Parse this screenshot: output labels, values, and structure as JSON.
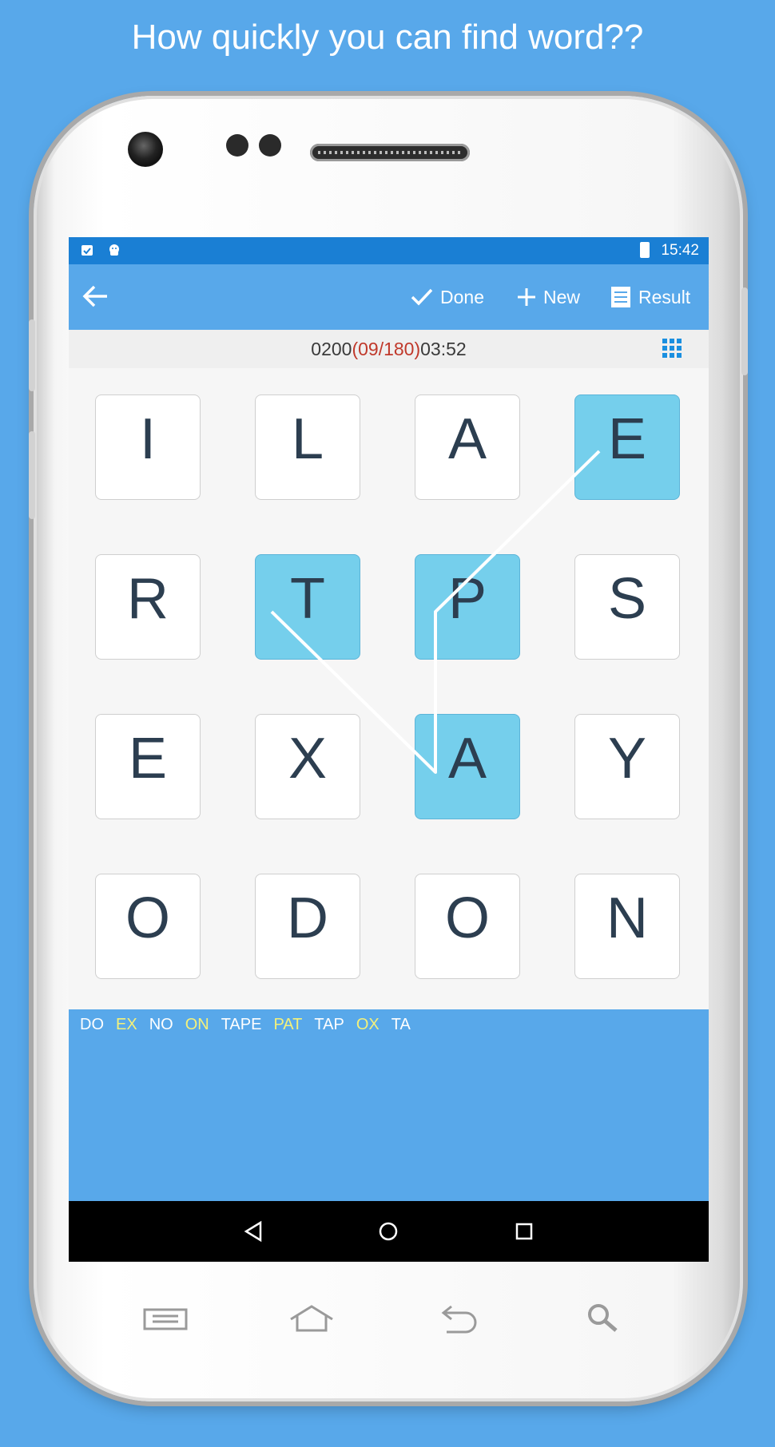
{
  "headline": "How quickly you can find word??",
  "status_bar": {
    "time": "15:42",
    "icons": [
      "clipboard-check-icon",
      "android-icon",
      "battery-charging-icon"
    ]
  },
  "toolbar": {
    "back_icon": "arrow-left-icon",
    "done_label": "Done",
    "new_label": "New",
    "result_label": "Result"
  },
  "score_bar": {
    "score": "0200",
    "found": "(09/180)",
    "timer": "03:52",
    "grid_icon": "grid-icon"
  },
  "board": {
    "rows": [
      [
        "I",
        "L",
        "A",
        "E"
      ],
      [
        "R",
        "T",
        "P",
        "S"
      ],
      [
        "E",
        "X",
        "A",
        "Y"
      ],
      [
        "O",
        "D",
        "O",
        "N"
      ]
    ],
    "selected": [
      [
        0,
        3
      ],
      [
        1,
        2
      ],
      [
        2,
        2
      ],
      [
        1,
        1
      ]
    ],
    "selected_color": "#75cfec"
  },
  "found_words": [
    {
      "text": "DO",
      "highlight": false
    },
    {
      "text": "EX",
      "highlight": true
    },
    {
      "text": "NO",
      "highlight": false
    },
    {
      "text": "ON",
      "highlight": true
    },
    {
      "text": "TAPE",
      "highlight": false
    },
    {
      "text": "PAT",
      "highlight": true
    },
    {
      "text": "TAP",
      "highlight": false
    },
    {
      "text": "OX",
      "highlight": true
    },
    {
      "text": "TA",
      "highlight": false
    }
  ],
  "nav_bar": [
    "back-triangle-icon",
    "home-circle-icon",
    "recents-square-icon"
  ],
  "hardware_keys": [
    "menu-icon",
    "home-icon",
    "back-icon",
    "search-icon"
  ],
  "colors": {
    "background": "#58a8ea",
    "status_bar": "#1a7fd4",
    "highlight_word": "#f4f17a",
    "score_red": "#c0392b"
  }
}
